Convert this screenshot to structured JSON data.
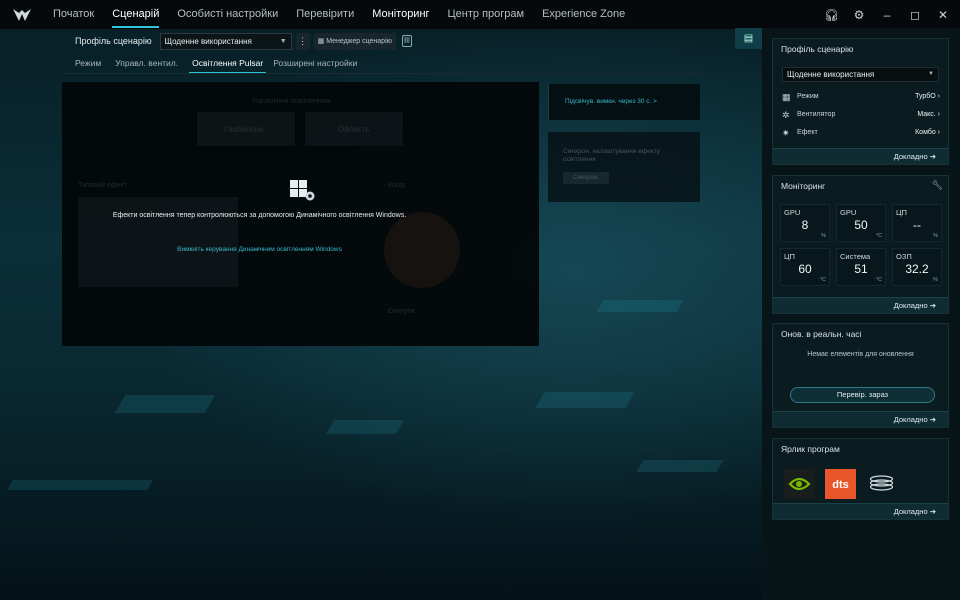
{
  "nav": {
    "items": [
      "Початок",
      "Сценарій",
      "Особисті настройки",
      "Перевірити",
      "Моніторинг",
      "Центр програм",
      "Experience Zone"
    ]
  },
  "toolbar": {
    "profile_label": "Профіль сценарію",
    "profile_value": "Щоденне використання",
    "manager_label": "Менеджер сценарію"
  },
  "subtabs": [
    "Режим",
    "Управл. вентил.",
    "Освітлення Pulsar",
    "Розширені настройки"
  ],
  "lighting": {
    "message": "Ефекти освітлення тепер контролюються за допомогою Динамічного освітлення Windows.",
    "disable_link": "Вимкніть керування Динамічним освітленням Windows",
    "ghost_title": "Управління освітленням",
    "ghost_tab_global": "Глобальне",
    "ghost_tab_area": "Область",
    "ghost_default": "Типовий ефект",
    "ghost_color": "Колір",
    "ghost_reset": "Скинути"
  },
  "side": {
    "backlight_link": "Підсвічув. вимкн. через 30 с. >",
    "sync_text": "Синхрон. налаштування ефекту освітлення",
    "sync_button": "Синхрон."
  },
  "right": {
    "profile_card": {
      "title": "Профіль сценарію",
      "select": "Щоденне використання",
      "rows": [
        {
          "icon": "mode-icon",
          "label": "Режим",
          "value": "ТурбО"
        },
        {
          "icon": "fan-icon",
          "label": "Вентилятор",
          "value": "Макс."
        },
        {
          "icon": "effect-icon",
          "label": "Ефект",
          "value": "Комбо"
        }
      ],
      "more": "Докладно"
    },
    "monitor_card": {
      "title": "Моніторинг",
      "tiles": [
        {
          "name": "GPU",
          "value": "8",
          "unit": "%"
        },
        {
          "name": "GPU",
          "value": "50",
          "unit": "°C"
        },
        {
          "name": "ЦП",
          "value": "--",
          "unit": "%"
        },
        {
          "name": "ЦП",
          "value": "60",
          "unit": "°C"
        },
        {
          "name": "Система",
          "value": "51",
          "unit": "°C"
        },
        {
          "name": "ОЗП",
          "value": "32.2",
          "unit": "%"
        }
      ],
      "more": "Докладно"
    },
    "update_card": {
      "title": "Онов. в реальн. часі",
      "empty": "Немає елементів для оновлення",
      "button": "Перевір. зараз",
      "more": "Докладно"
    },
    "apps_card": {
      "title": "Ярлик програм",
      "apps": [
        "nvidia-icon",
        "dts-icon",
        "coil-icon"
      ],
      "more": "Докладно"
    }
  },
  "colors": {
    "accent": "#2fc3d8",
    "link": "#38b7cb"
  }
}
